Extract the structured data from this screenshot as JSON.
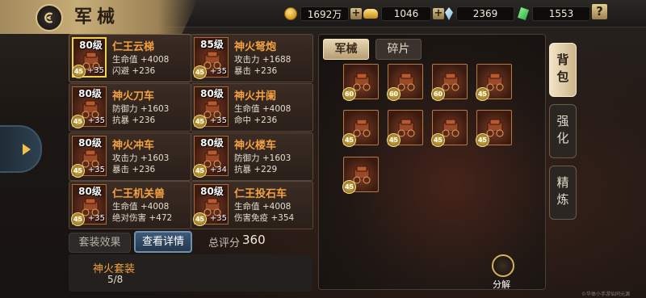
{
  "header": {
    "title": "军械",
    "back_icon": "back-swirl-icon"
  },
  "resources": [
    {
      "name": "coin-icon",
      "value": "1692万"
    },
    {
      "name": "ingot-icon",
      "value": "1046"
    },
    {
      "name": "crystal-icon",
      "value": "2369"
    },
    {
      "name": "jade-icon",
      "value": "1553"
    }
  ],
  "help_label": "?",
  "cards": [
    {
      "level": "80级",
      "name": "仁王云梯",
      "stat1": "生命值 +4008",
      "stat2": "闪避 +236",
      "star": "45",
      "bonus": "+35",
      "selected": true
    },
    {
      "level": "85级",
      "name": "神火弩炮",
      "stat1": "攻击力 +1688",
      "stat2": "暴击 +236",
      "star": "45",
      "bonus": "+35"
    },
    {
      "level": "80级",
      "name": "神火刀车",
      "stat1": "防御力 +1603",
      "stat2": "抗暴 +236",
      "star": "45",
      "bonus": "+35"
    },
    {
      "level": "80级",
      "name": "神火井阑",
      "stat1": "生命值 +4008",
      "stat2": "命中 +236",
      "star": "45",
      "bonus": "+35"
    },
    {
      "level": "80级",
      "name": "神火冲车",
      "stat1": "攻击力 +1603",
      "stat2": "暴击 +236",
      "star": "45",
      "bonus": "+35"
    },
    {
      "level": "80级",
      "name": "神火楼车",
      "stat1": "防御力 +1603",
      "stat2": "抗暴 +229",
      "star": "45",
      "bonus": "+34"
    },
    {
      "level": "80级",
      "name": "仁王机关兽",
      "stat1": "生命值 +4008",
      "stat2": "绝对伤害 +472",
      "star": "45",
      "bonus": "+35"
    },
    {
      "level": "80级",
      "name": "仁王投石车",
      "stat1": "生命值 +4008",
      "stat2": "伤害免疫 +354",
      "star": "45",
      "bonus": "+35"
    }
  ],
  "buttons": {
    "suit_effect": "套装效果",
    "view_detail": "查看详情"
  },
  "score": {
    "label": "总评分",
    "value": "360"
  },
  "set": {
    "name": "神火套装",
    "count": "5/8"
  },
  "inventory": {
    "tabs": [
      "军械",
      "碎片"
    ],
    "slots": [
      "60",
      "60",
      "60",
      "45",
      "45",
      "45",
      "45",
      "45",
      "45"
    ],
    "decompose_label": "分解"
  },
  "side_tabs": [
    "背包",
    "强化",
    "精炼"
  ],
  "watermark": "©华体小手游仙同元源",
  "colors": {
    "accent_orange": "#f3a140",
    "gold": "#e0b94f"
  }
}
